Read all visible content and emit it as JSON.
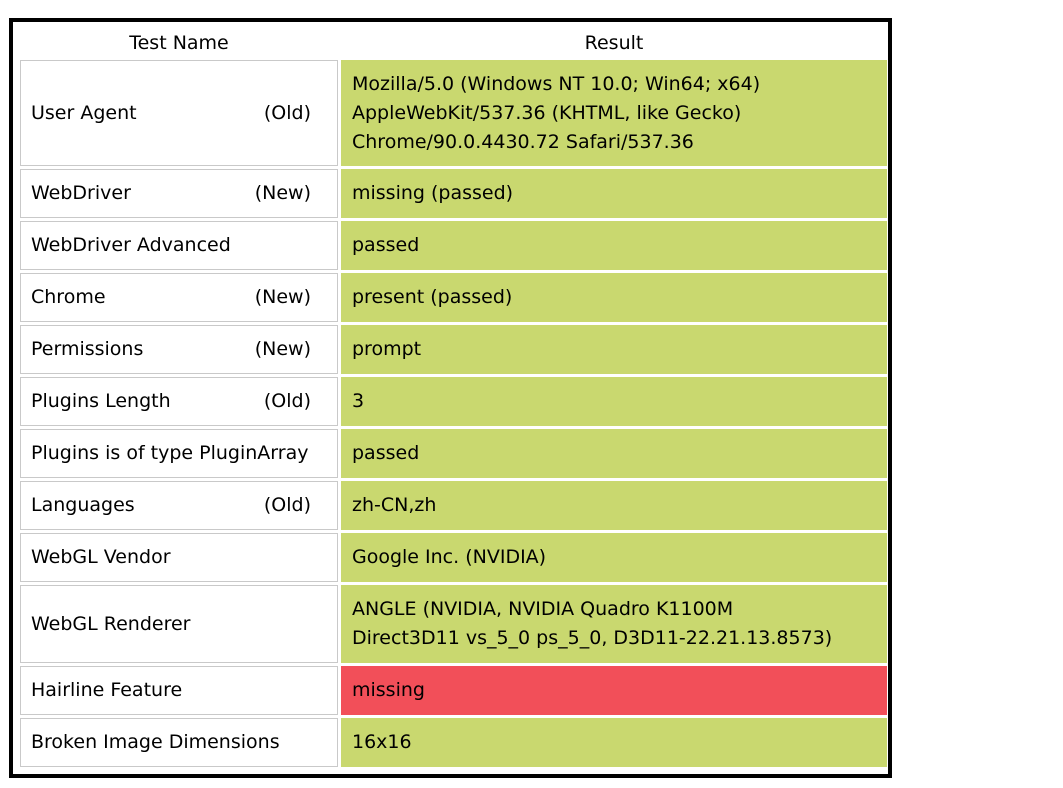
{
  "header": {
    "test_name": "Test Name",
    "result": "Result"
  },
  "colors": {
    "passed": "#c9d86f",
    "failed": "#f24f59"
  },
  "rows": [
    {
      "name": "User Agent",
      "tag": "(Old)",
      "result_lines": [
        "Mozilla/5.0 (Windows NT 10.0; Win64; x64)",
        "AppleWebKit/537.36 (KHTML, like Gecko)",
        "Chrome/90.0.4430.72 Safari/537.36"
      ],
      "status": "passed"
    },
    {
      "name": "WebDriver",
      "tag": "(New)",
      "result": "missing (passed)",
      "status": "passed"
    },
    {
      "name": "WebDriver Advanced",
      "tag": "",
      "result": "passed",
      "status": "passed"
    },
    {
      "name": "Chrome",
      "tag": "(New)",
      "result": "present (passed)",
      "status": "passed"
    },
    {
      "name": "Permissions",
      "tag": "(New)",
      "result": "prompt",
      "status": "passed"
    },
    {
      "name": "Plugins Length",
      "tag": "(Old)",
      "result": "3",
      "status": "passed"
    },
    {
      "name": "Plugins is of type PluginArray",
      "tag": "",
      "result": "passed",
      "status": "passed"
    },
    {
      "name": "Languages",
      "tag": "(Old)",
      "result": "zh-CN,zh",
      "status": "passed"
    },
    {
      "name": "WebGL Vendor",
      "tag": "",
      "result": "Google Inc. (NVIDIA)",
      "status": "passed"
    },
    {
      "name": "WebGL Renderer",
      "tag": "",
      "result_lines": [
        "ANGLE (NVIDIA, NVIDIA Quadro K1100M",
        "Direct3D11 vs_5_0 ps_5_0, D3D11-22.21.13.8573)"
      ],
      "status": "passed"
    },
    {
      "name": "Hairline Feature",
      "tag": "",
      "result": "missing",
      "status": "failed"
    },
    {
      "name": "Broken Image Dimensions",
      "tag": "",
      "result": "16x16",
      "status": "passed"
    }
  ]
}
